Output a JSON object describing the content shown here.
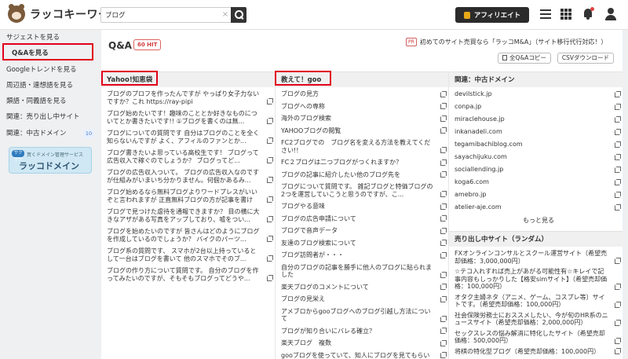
{
  "header": {
    "logo_text": "ラッコキーワード",
    "search_value": "ブログ",
    "search_clear": "×",
    "affiliate_label": "アフィリエイト"
  },
  "sidebar": {
    "items": [
      {
        "label": "サジェストを見る"
      },
      {
        "label": "Q&Aを見る"
      },
      {
        "label": "Googleトレンドを見る"
      },
      {
        "label": "周辺語・連想語を見る"
      },
      {
        "label": "類語・同義語を見る"
      },
      {
        "label": "関連：売り出し中サイト"
      },
      {
        "label": "関連：中古ドメイン"
      }
    ],
    "domain_count": "10",
    "banner": {
      "circle": "サクサク",
      "subtitle": "買くドメイン管理サービス",
      "title": "ラッコドメイン"
    }
  },
  "main": {
    "title": "Q&A",
    "hit_badge": "60 HIT",
    "pr": "PR",
    "pr_text": "初めてのサイト売買なら「ラッコM&A」（サイト移行代行対応！）",
    "copy_label": "全Q&Aコピー",
    "csv_label": "CSVダウンロード",
    "yahoo": {
      "header": "Yahoo!知恵袋",
      "items": [
        "ブログのプロフを作ったんですが やっぱり女子力ないですか？これ https://ray-pipi",
        "ブログ始めたいです！趣味のこととか好きなものについてとか書きたいです!! ①ブログを書くのは無...",
        "ブログについての質問です 自分はブログのことを全く知らないんですが よく、アフィルのファンとか...",
        "ブログ書きたいよ思っている高校生です！ ブログって広告収入で稼ぐのでしょうか？ ブログってど...",
        "ブログの広告収入ついて。 ブログの広告収入なのですが仕組みがいまいち分かりません。何個かあるみ...",
        "ブログ始めるなら無料ブログよりワードプレスがいいぞと言われますが 正直無料ブログの方が記事を書け",
        "ブログで見つけた虐待を通報できますか？ 目の横に大きなアザがある写真をアップしており、嘘をつい...",
        "ブログを始めたいのですが 皆さんはどのようにブログを作成しているのでしょうか？ バイクのパーツ...",
        "ブログ系の質問です、 スマホが2台以上持っているとして一台はブログを書いて 他のスマホでそのブ...",
        "ブログの作り方について質問です。 自分のブログを作ってみたいのですが、そもそもブログってどうや..."
      ]
    },
    "goo": {
      "header": "教えて！goo",
      "items": [
        "ブログの見方",
        "ブログへの専称",
        "海外のブログ検索",
        "YAHOOブログの閲覧",
        "FC2ブログでの　ブログ名を変える方法を教えてください!!",
        "FC２ブログは二つブログがつくれますか？",
        "ブログの記事に紹介したい他のブログ先を",
        "ブログについて質問です。 雑記ブログと特価ブログの2つを運営していこうと思うのですが、こ...",
        "ブログやる意味",
        "ブログの広告申請について",
        "ブログで音声データ",
        "友達のブログ検索について",
        "ブログ訪問者が・・・",
        "自分のブログの記事を勝手に他人のブログに貼られました",
        "楽天ブログのコメントについて",
        "ブログの見栄え",
        "アメブロからgooブログへのブログ引越し方法について",
        "ブログが知り合いにバレる確立？",
        "楽天ブログ　複数",
        "gooブログを使っていて、知人にブログを見てもらい"
      ]
    },
    "domains": {
      "header": "関連：中古ドメイン",
      "items": [
        "devilstick.jp",
        "conpa.jp",
        "miraclehouse.jp",
        "inkanadeli.com",
        "tegamibachiblog.com",
        "sayachijuku.com",
        "sociallending.jp",
        "koga6.com",
        "amebro.jp",
        "atelier-aje.com"
      ],
      "more": "もっと見る"
    },
    "sites": {
      "header": "売り出し中サイト（ランダム）",
      "items": [
        "FXオンラインコンサルとスクール運営サイト（希望売却価格：3,000,000円）",
        "☆テコ入れすれば売上があがる可能性有☆キレイで記事内容もしっかりした【格安simサイト】（希望売却価格：100,000円）",
        "オタク主婦ネタ（アニメ、ゲーム、コスプレ等）サイトです。（希望売却価格：100,000円）",
        "社会保険労務士におススメしたい、今が旬のHR系のニュースサイト（希望売却価格：2,000,000円）",
        "セックスレスの悩み解消に特化したサイト（希望売却価格：500,000円）",
        "将棋の特化型ブログ（希望売却価格：100,000円）"
      ]
    }
  }
}
